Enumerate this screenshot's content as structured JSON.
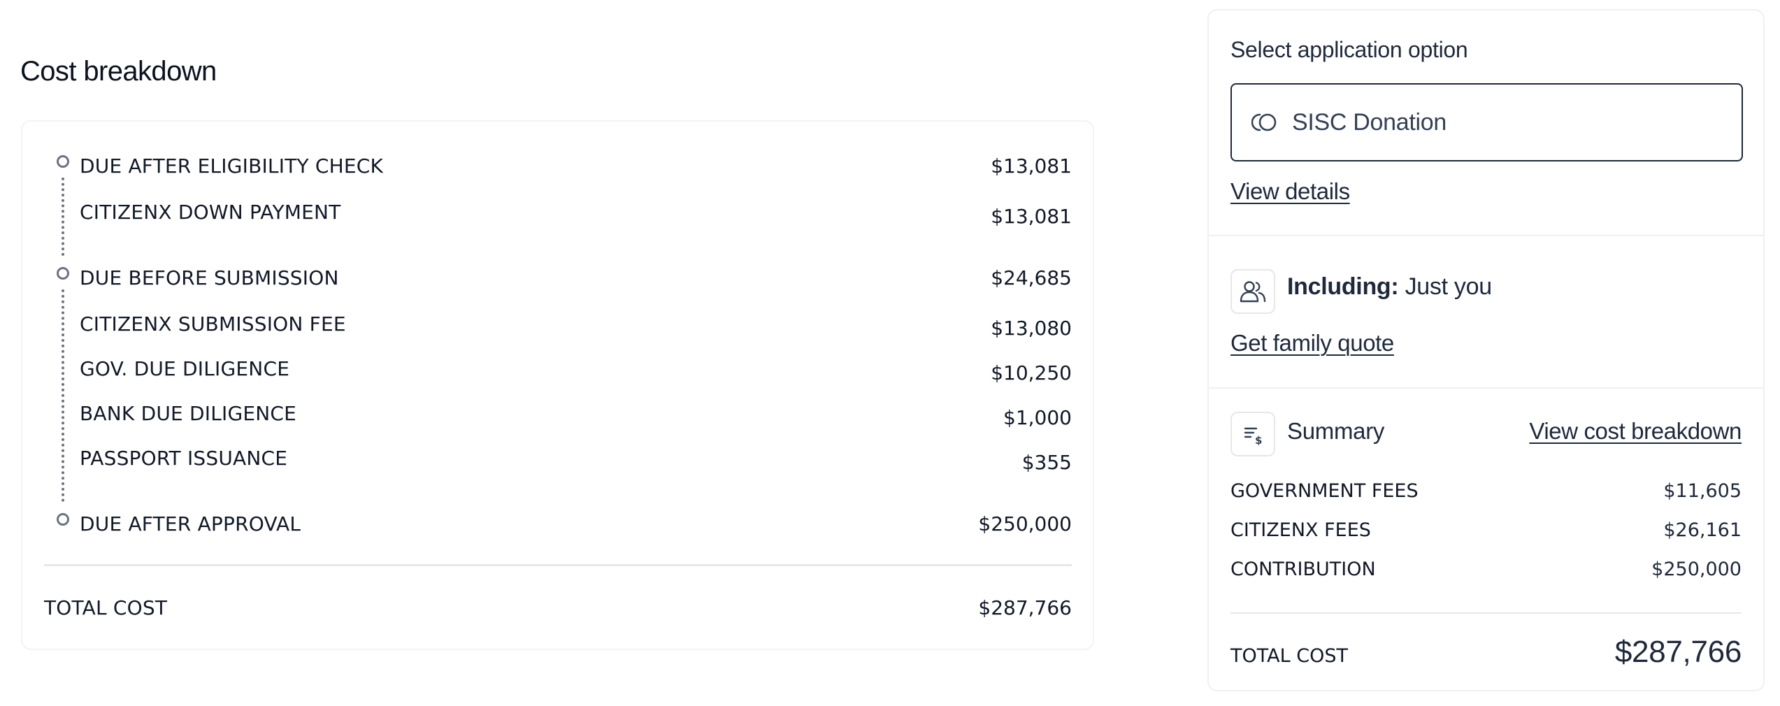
{
  "breakdown": {
    "title": "Cost breakdown",
    "groups": [
      {
        "label": "DUE AFTER ELIGIBILITY CHECK",
        "value": "$13,081",
        "items": [
          {
            "label": "CITIZENX DOWN PAYMENT",
            "value": "$13,081"
          }
        ]
      },
      {
        "label": "DUE BEFORE SUBMISSION",
        "value": "$24,685",
        "items": [
          {
            "label": "CITIZENX SUBMISSION FEE",
            "value": "$13,080"
          },
          {
            "label": "GOV. DUE DILIGENCE",
            "value": "$10,250"
          },
          {
            "label": "BANK DUE DILIGENCE",
            "value": "$1,000"
          },
          {
            "label": "PASSPORT ISSUANCE",
            "value": "$355"
          }
        ]
      },
      {
        "label": "DUE AFTER APPROVAL",
        "value": "$250,000",
        "items": []
      }
    ],
    "total_label": "TOTAL COST",
    "total_value": "$287,766"
  },
  "panel": {
    "option_title": "Select application option",
    "option_selected": "SISC Donation",
    "option_icon": "coins-icon",
    "view_details_link": "View details",
    "including_label": "Including:",
    "including_value": "Just you",
    "including_icon": "users-icon",
    "family_quote_link": "Get family quote",
    "summary_title": "Summary",
    "summary_icon": "receipt-dollar-icon",
    "view_breakdown_link": "View cost breakdown",
    "summary_rows": [
      {
        "label": "GOVERNMENT FEES",
        "value": "$11,605"
      },
      {
        "label": "CITIZENX FEES",
        "value": "$26,161"
      },
      {
        "label": "CONTRIBUTION",
        "value": "$250,000"
      }
    ],
    "total_label": "TOTAL COST",
    "total_value": "$287,766"
  },
  "colors": {
    "text_primary": "#0f172a",
    "text_slate": "#1e293b",
    "timeline_gray": "#6b7280",
    "border_light": "#eef0f3"
  }
}
